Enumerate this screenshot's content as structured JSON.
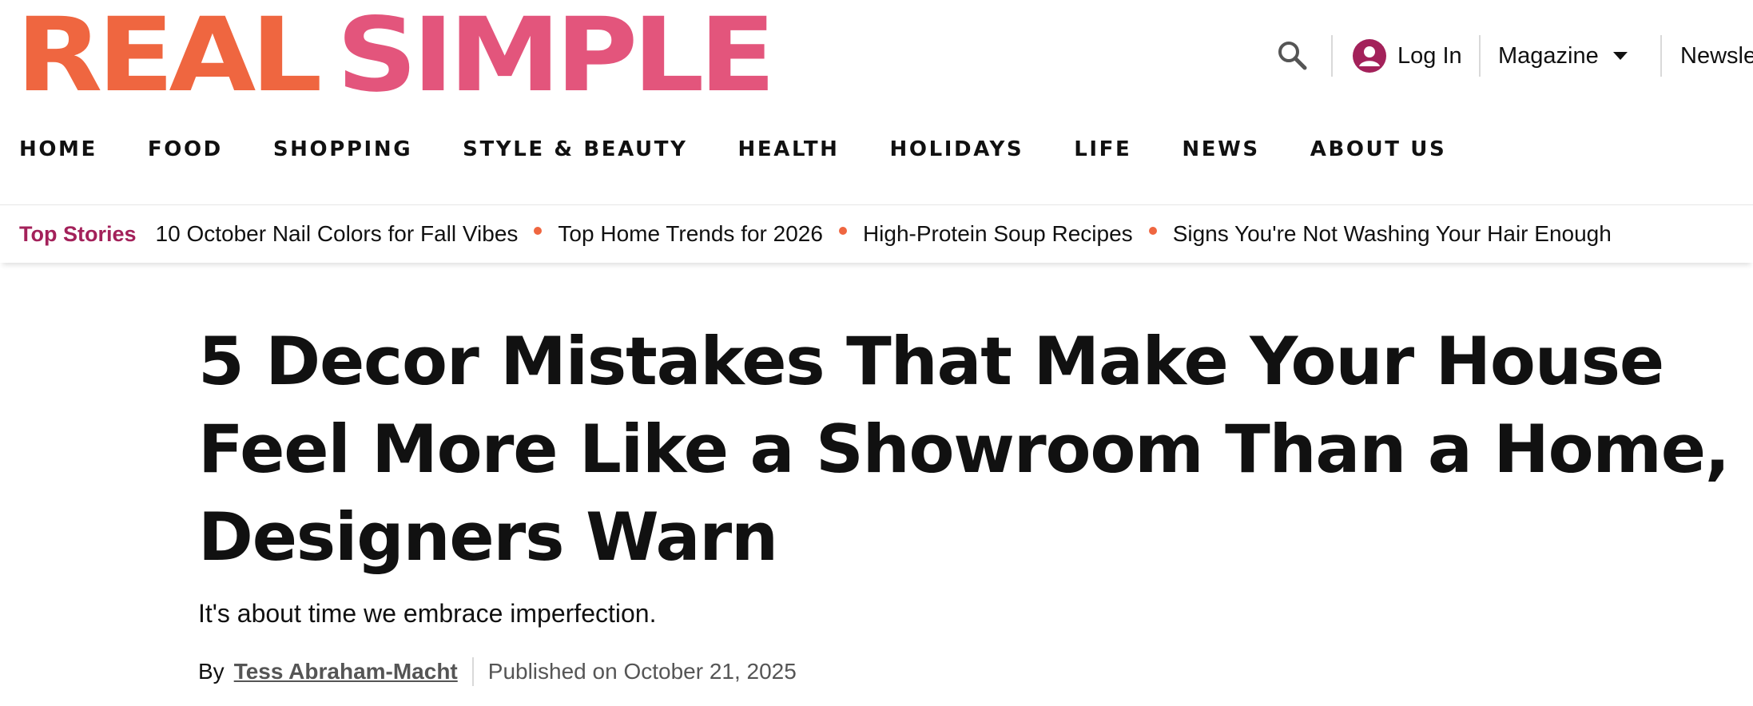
{
  "brand": {
    "logo_part1": "REAL",
    "logo_part2": "SIMPLE",
    "colors": {
      "real": "#ef6640",
      "simple": "#e3557c",
      "accent": "#a3215a",
      "dot": "#ef6640"
    }
  },
  "utility": {
    "search_icon": "search-icon",
    "login_label": "Log In",
    "login_icon": "user-circle-icon",
    "magazine_label": "Magazine",
    "newsletter_label": "Newsle"
  },
  "nav": {
    "items": [
      {
        "label": "HOME"
      },
      {
        "label": "FOOD"
      },
      {
        "label": "SHOPPING"
      },
      {
        "label": "STYLE & BEAUTY"
      },
      {
        "label": "HEALTH"
      },
      {
        "label": "HOLIDAYS"
      },
      {
        "label": "LIFE"
      },
      {
        "label": "NEWS"
      },
      {
        "label": "ABOUT US"
      }
    ]
  },
  "top_stories": {
    "label": "Top Stories",
    "links": [
      {
        "label": "10 October Nail Colors for Fall Vibes"
      },
      {
        "label": "Top Home Trends for 2026"
      },
      {
        "label": "High-Protein Soup Recipes"
      },
      {
        "label": "Signs You're Not Washing Your Hair Enough"
      }
    ]
  },
  "article": {
    "headline": "5 Decor Mistakes That Make Your House Feel More Like a Showroom Than a Home, Designers Warn",
    "dek": "It's about time we embrace imperfection.",
    "byline_prefix": "By",
    "author": "Tess Abraham-Macht",
    "published": "Published on October 21, 2025"
  }
}
